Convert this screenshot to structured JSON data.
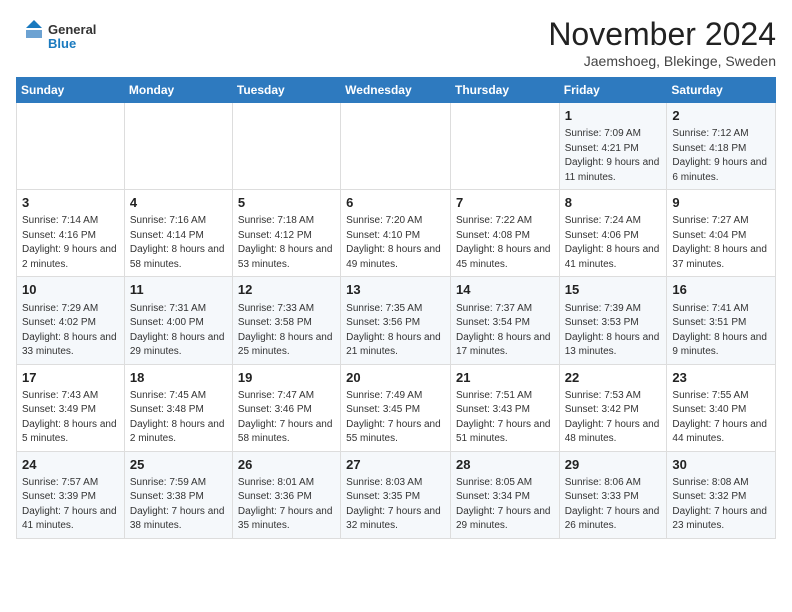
{
  "logo": {
    "name_part1": "General",
    "name_part2": "Blue"
  },
  "title": "November 2024",
  "subtitle": "Jaemshoeg, Blekinge, Sweden",
  "days_header": [
    "Sunday",
    "Monday",
    "Tuesday",
    "Wednesday",
    "Thursday",
    "Friday",
    "Saturday"
  ],
  "weeks": [
    [
      {
        "day": "",
        "info": ""
      },
      {
        "day": "",
        "info": ""
      },
      {
        "day": "",
        "info": ""
      },
      {
        "day": "",
        "info": ""
      },
      {
        "day": "",
        "info": ""
      },
      {
        "day": "1",
        "info": "Sunrise: 7:09 AM\nSunset: 4:21 PM\nDaylight: 9 hours and 11 minutes."
      },
      {
        "day": "2",
        "info": "Sunrise: 7:12 AM\nSunset: 4:18 PM\nDaylight: 9 hours and 6 minutes."
      }
    ],
    [
      {
        "day": "3",
        "info": "Sunrise: 7:14 AM\nSunset: 4:16 PM\nDaylight: 9 hours and 2 minutes."
      },
      {
        "day": "4",
        "info": "Sunrise: 7:16 AM\nSunset: 4:14 PM\nDaylight: 8 hours and 58 minutes."
      },
      {
        "day": "5",
        "info": "Sunrise: 7:18 AM\nSunset: 4:12 PM\nDaylight: 8 hours and 53 minutes."
      },
      {
        "day": "6",
        "info": "Sunrise: 7:20 AM\nSunset: 4:10 PM\nDaylight: 8 hours and 49 minutes."
      },
      {
        "day": "7",
        "info": "Sunrise: 7:22 AM\nSunset: 4:08 PM\nDaylight: 8 hours and 45 minutes."
      },
      {
        "day": "8",
        "info": "Sunrise: 7:24 AM\nSunset: 4:06 PM\nDaylight: 8 hours and 41 minutes."
      },
      {
        "day": "9",
        "info": "Sunrise: 7:27 AM\nSunset: 4:04 PM\nDaylight: 8 hours and 37 minutes."
      }
    ],
    [
      {
        "day": "10",
        "info": "Sunrise: 7:29 AM\nSunset: 4:02 PM\nDaylight: 8 hours and 33 minutes."
      },
      {
        "day": "11",
        "info": "Sunrise: 7:31 AM\nSunset: 4:00 PM\nDaylight: 8 hours and 29 minutes."
      },
      {
        "day": "12",
        "info": "Sunrise: 7:33 AM\nSunset: 3:58 PM\nDaylight: 8 hours and 25 minutes."
      },
      {
        "day": "13",
        "info": "Sunrise: 7:35 AM\nSunset: 3:56 PM\nDaylight: 8 hours and 21 minutes."
      },
      {
        "day": "14",
        "info": "Sunrise: 7:37 AM\nSunset: 3:54 PM\nDaylight: 8 hours and 17 minutes."
      },
      {
        "day": "15",
        "info": "Sunrise: 7:39 AM\nSunset: 3:53 PM\nDaylight: 8 hours and 13 minutes."
      },
      {
        "day": "16",
        "info": "Sunrise: 7:41 AM\nSunset: 3:51 PM\nDaylight: 8 hours and 9 minutes."
      }
    ],
    [
      {
        "day": "17",
        "info": "Sunrise: 7:43 AM\nSunset: 3:49 PM\nDaylight: 8 hours and 5 minutes."
      },
      {
        "day": "18",
        "info": "Sunrise: 7:45 AM\nSunset: 3:48 PM\nDaylight: 8 hours and 2 minutes."
      },
      {
        "day": "19",
        "info": "Sunrise: 7:47 AM\nSunset: 3:46 PM\nDaylight: 7 hours and 58 minutes."
      },
      {
        "day": "20",
        "info": "Sunrise: 7:49 AM\nSunset: 3:45 PM\nDaylight: 7 hours and 55 minutes."
      },
      {
        "day": "21",
        "info": "Sunrise: 7:51 AM\nSunset: 3:43 PM\nDaylight: 7 hours and 51 minutes."
      },
      {
        "day": "22",
        "info": "Sunrise: 7:53 AM\nSunset: 3:42 PM\nDaylight: 7 hours and 48 minutes."
      },
      {
        "day": "23",
        "info": "Sunrise: 7:55 AM\nSunset: 3:40 PM\nDaylight: 7 hours and 44 minutes."
      }
    ],
    [
      {
        "day": "24",
        "info": "Sunrise: 7:57 AM\nSunset: 3:39 PM\nDaylight: 7 hours and 41 minutes."
      },
      {
        "day": "25",
        "info": "Sunrise: 7:59 AM\nSunset: 3:38 PM\nDaylight: 7 hours and 38 minutes."
      },
      {
        "day": "26",
        "info": "Sunrise: 8:01 AM\nSunset: 3:36 PM\nDaylight: 7 hours and 35 minutes."
      },
      {
        "day": "27",
        "info": "Sunrise: 8:03 AM\nSunset: 3:35 PM\nDaylight: 7 hours and 32 minutes."
      },
      {
        "day": "28",
        "info": "Sunrise: 8:05 AM\nSunset: 3:34 PM\nDaylight: 7 hours and 29 minutes."
      },
      {
        "day": "29",
        "info": "Sunrise: 8:06 AM\nSunset: 3:33 PM\nDaylight: 7 hours and 26 minutes."
      },
      {
        "day": "30",
        "info": "Sunrise: 8:08 AM\nSunset: 3:32 PM\nDaylight: 7 hours and 23 minutes."
      }
    ]
  ]
}
